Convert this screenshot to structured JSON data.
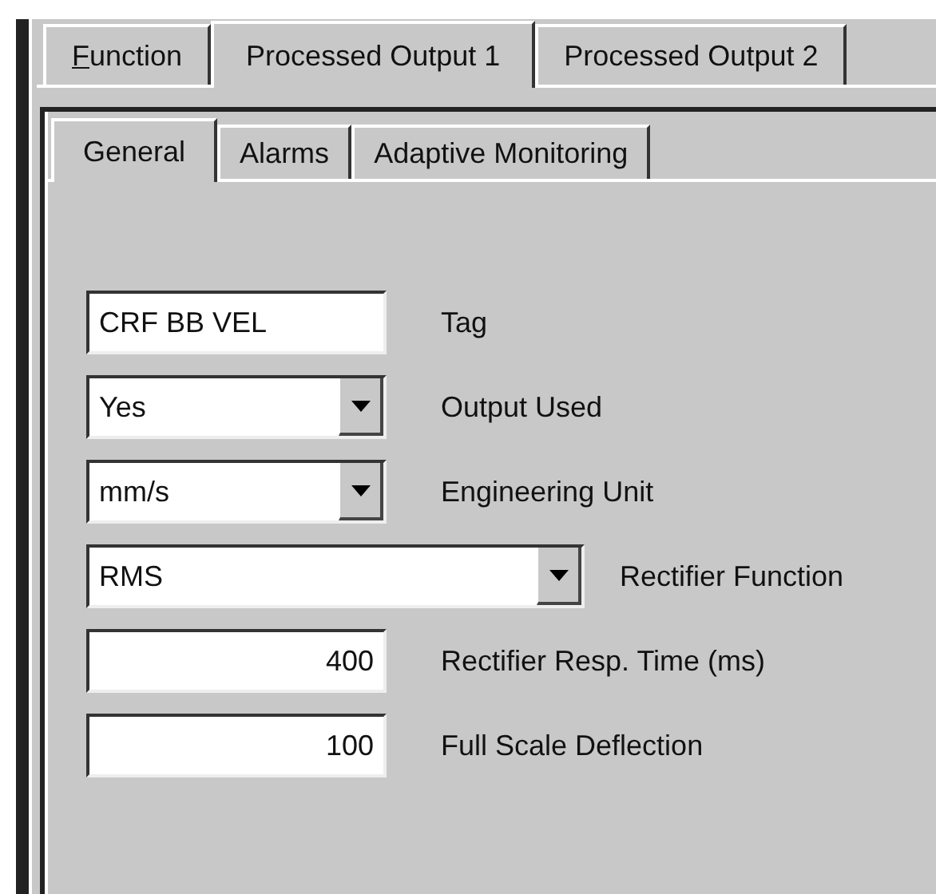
{
  "tabs": [
    {
      "label": "Function",
      "mnemonic": true,
      "selected": false
    },
    {
      "label": "Processed Output 1",
      "mnemonic": false,
      "selected": true
    },
    {
      "label": "Processed Output 2",
      "mnemonic": false,
      "selected": false
    }
  ],
  "subtabs": [
    {
      "label": "General",
      "selected": true
    },
    {
      "label": "Alarms",
      "selected": false
    },
    {
      "label": "Adaptive Monitoring",
      "selected": false
    }
  ],
  "fields": [
    {
      "kind": "text",
      "value": "CRF BB VEL",
      "label": "Tag"
    },
    {
      "kind": "dropdown",
      "value": "Yes",
      "label": "Output Used"
    },
    {
      "kind": "dropdown",
      "value": "mm/s",
      "label": "Engineering Unit"
    },
    {
      "kind": "wide-dropdown",
      "value": "RMS",
      "label": "Rectifier Function"
    },
    {
      "kind": "number",
      "value": "400",
      "label": "Rectifier Resp. Time (ms)"
    },
    {
      "kind": "number",
      "value": "100",
      "label": "Full Scale Deflection"
    }
  ]
}
